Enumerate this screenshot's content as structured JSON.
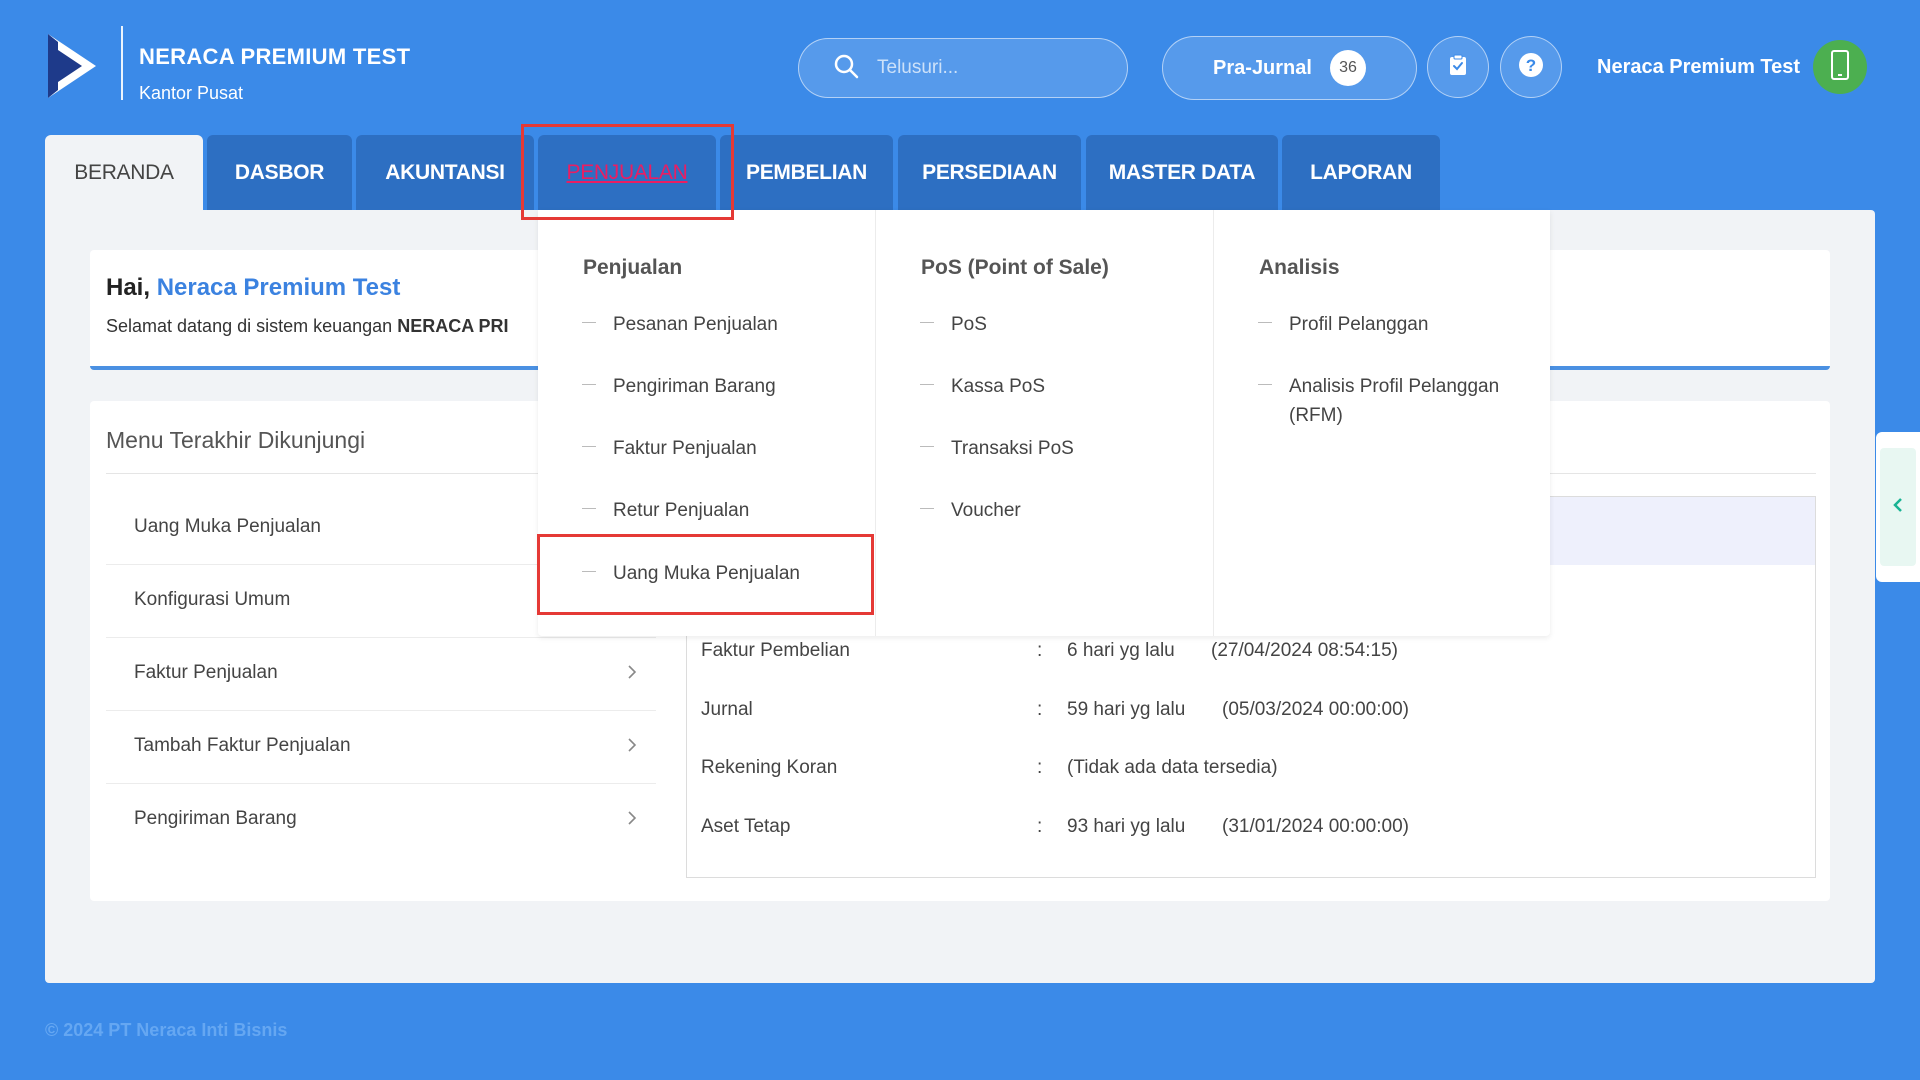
{
  "brand": {
    "title": "NERACA PREMIUM TEST",
    "subtitle": "Kantor Pusat"
  },
  "search": {
    "placeholder": "Telusuri..."
  },
  "prajurnal": {
    "label": "Pra-Jurnal",
    "count": "36"
  },
  "user": {
    "name": "Neraca Premium Test"
  },
  "tabs": [
    {
      "label": "BERANDA"
    },
    {
      "label": "DASBOR"
    },
    {
      "label": "AKUNTANSI"
    },
    {
      "label": "PENJUALAN"
    },
    {
      "label": "PEMBELIAN"
    },
    {
      "label": "PERSEDIAAN"
    },
    {
      "label": "MASTER DATA"
    },
    {
      "label": "LAPORAN"
    }
  ],
  "greeting": {
    "hai": "Hai,",
    "name": "Neraca Premium Test",
    "welcome": "Selamat datang di sistem keuangan",
    "product": "NERACA PRI"
  },
  "recent": {
    "title": "Menu Terakhir Dikunjungi",
    "items": [
      {
        "label": "Uang Muka Penjualan"
      },
      {
        "label": "Konfigurasi Umum"
      },
      {
        "label": "Faktur Penjualan"
      },
      {
        "label": "Tambah Faktur Penjualan"
      },
      {
        "label": "Pengiriman Barang"
      }
    ]
  },
  "activity": [
    {
      "name": "Faktur Pembelian",
      "sep": ":",
      "ago": "6 hari yg lalu",
      "date": "(27/04/2024 08:54:15)"
    },
    {
      "name": "Jurnal",
      "sep": ":",
      "ago": "59 hari yg lalu",
      "date": "(05/03/2024 00:00:00)"
    },
    {
      "name": "Rekening Koran",
      "sep": ":",
      "ago": "(Tidak ada data tersedia)",
      "date": ""
    },
    {
      "name": "Aset Tetap",
      "sep": ":",
      "ago": "93 hari yg lalu",
      "date": "(31/01/2024 00:00:00)"
    }
  ],
  "dropdown": {
    "penjualan": {
      "title": "Penjualan",
      "items": [
        "Pesanan Penjualan",
        "Pengiriman Barang",
        "Faktur Penjualan",
        "Retur Penjualan",
        "Uang Muka Penjualan"
      ]
    },
    "pos": {
      "title": "PoS (Point of Sale)",
      "items": [
        "PoS",
        "Kassa PoS",
        "Transaksi PoS",
        "Voucher"
      ]
    },
    "analisis": {
      "title": "Analisis",
      "items": [
        "Profil Pelanggan",
        "Analisis Profil Pelanggan (RFM)"
      ]
    }
  },
  "footer": "© 2024 PT Neraca Inti Bisnis",
  "icons": {
    "logo": "brand-logo-icon",
    "search": "search-icon",
    "tasks": "clipboard-check-icon",
    "help": "help-icon",
    "avatar": "mobile-phone-icon",
    "chevron": "chevron-right-icon",
    "side": "chevron-left-icon"
  },
  "colors": {
    "background": "#3b8ae8",
    "tab": "#2d6fc2",
    "tab_hover_text": "#e91e63",
    "highlight": "#e53935",
    "accent": "#3b82e0",
    "avatar": "#4caf50"
  }
}
